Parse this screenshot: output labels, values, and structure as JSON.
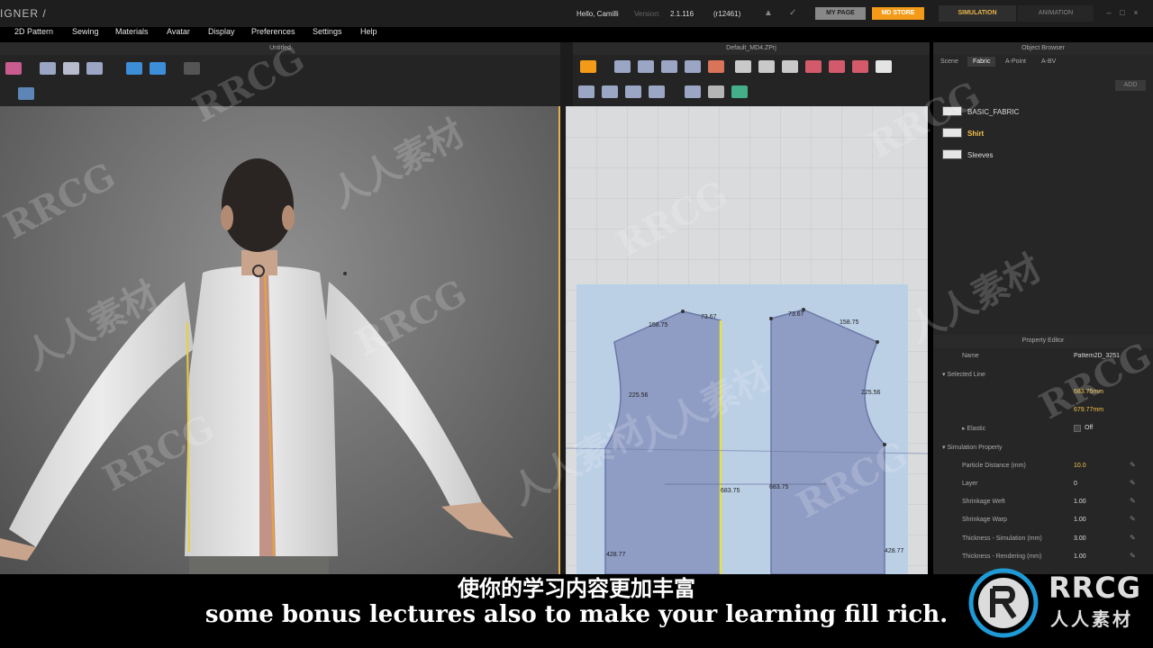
{
  "app": {
    "title": "IGNER /"
  },
  "top": {
    "greeting": "Hello, Camilli",
    "version_label": "Version:",
    "version": "2.1.116",
    "build": "(r12461)",
    "mypage_label": "MY PAGE",
    "mdstore_label": "MD STORE",
    "mode_tabs": [
      "SIMULATION",
      "ANIMATION"
    ]
  },
  "menubar": [
    "2D Pattern",
    "Sewing",
    "Materials",
    "Avatar",
    "Display",
    "Preferences",
    "Settings",
    "Help"
  ],
  "panels": {
    "left_title": "Untitled",
    "mid_title": "Default_MD4.ZPrj",
    "right_title": "Object Browser",
    "property_title": "Property Editor"
  },
  "object_browser": {
    "tabs": [
      "Scene",
      "Fabric",
      "A-Point",
      "A-BV"
    ],
    "add_label": "ADD",
    "fabrics": [
      {
        "name": "BASIC_FABRIC",
        "selected": false
      },
      {
        "name": "Shirt",
        "selected": true
      },
      {
        "name": "Sleeves",
        "selected": false
      }
    ]
  },
  "property_editor": {
    "name_label": "Name",
    "name_value": "Pattern2D_3251",
    "selected_line": "Selected Line",
    "line_length_1": "683.75mm",
    "line_length_2": "679.77mm",
    "elastic_label": "Elastic",
    "elastic_value": "Off",
    "sim_section": "Simulation Property",
    "props": [
      {
        "label": "Particle Distance (mm)",
        "value": "10.0",
        "highlight": true
      },
      {
        "label": "Layer",
        "value": "0",
        "highlight": false
      },
      {
        "label": "Shrinkage Weft",
        "value": "1.00",
        "highlight": false
      },
      {
        "label": "Shrinkage Warp",
        "value": "1.00",
        "highlight": false
      },
      {
        "label": "Thickness - Simulation (mm)",
        "value": "3.00",
        "highlight": false
      },
      {
        "label": "Thickness - Rendering (mm)",
        "value": "1.00",
        "highlight": false
      }
    ]
  },
  "pattern_labels": {
    "left_shoulder": "158.75",
    "left_neck": "73.67",
    "right_neck": "73.67",
    "right_shoulder": "158.75",
    "left_armhole": "225.56",
    "right_armhole": "225.56",
    "center_left": "683.75",
    "center_right": "683.75",
    "left_side": "428.77",
    "right_side": "428.77"
  },
  "subtitles": {
    "zh": "使你的学习内容更加丰富",
    "en": "some bonus lectures also to make your learning fill rich."
  },
  "watermarks": {
    "latin": "RRCG",
    "cjk": "人人素材"
  },
  "colors": {
    "accent": "#f39b18",
    "selection": "#e7b14a",
    "pattern_fill": "#8f9cc4",
    "pattern_bg": "#b7cde6"
  }
}
